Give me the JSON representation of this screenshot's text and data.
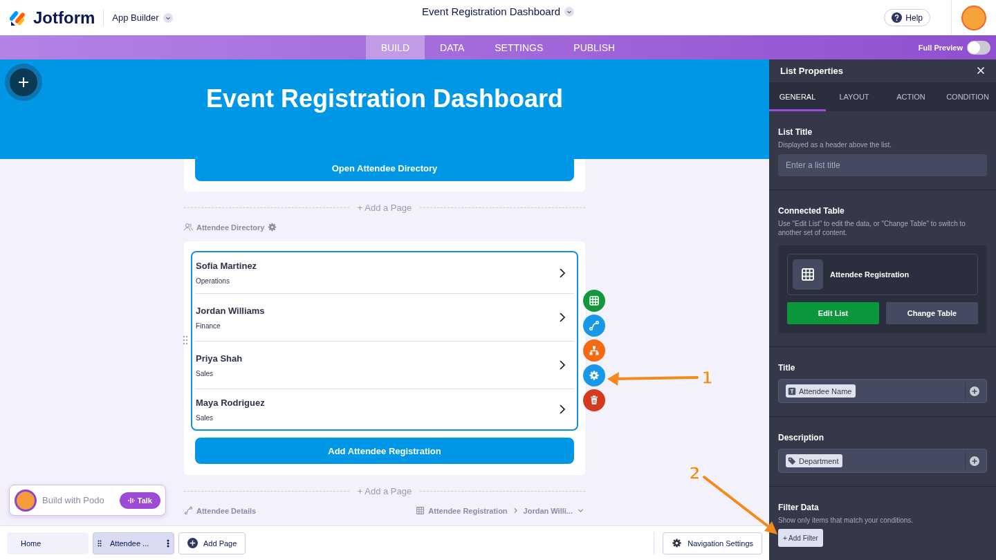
{
  "header": {
    "brand": "Jotform",
    "product": "App Builder",
    "app_title": "Event Registration Dashboard",
    "help": "Help"
  },
  "nav": {
    "tabs": [
      {
        "label": "BUILD",
        "selected": true
      },
      {
        "label": "DATA",
        "selected": false
      },
      {
        "label": "SETTINGS",
        "selected": false
      },
      {
        "label": "PUBLISH",
        "selected": false
      }
    ],
    "full_preview": {
      "label": "Full Preview",
      "on": false
    }
  },
  "canvas": {
    "banner_title": "Event Registration Dashboard",
    "first_page": {
      "button": "Open Attendee Directory"
    },
    "add_page_labels": [
      "+ Add a Page",
      "+ Add a Page"
    ],
    "list_page": {
      "label": "Attendee Directory",
      "items": [
        {
          "title": "Sofia Martinez",
          "description": "Operations"
        },
        {
          "title": "Jordan Williams",
          "description": "Finance"
        },
        {
          "title": "Priya Shah",
          "description": "Sales"
        },
        {
          "title": "Maya Rodriguez",
          "description": "Sales"
        }
      ],
      "add_button": "Add Attendee Registration",
      "actions": [
        {
          "kind": "table"
        },
        {
          "kind": "link"
        },
        {
          "kind": "hierarchy"
        },
        {
          "kind": "settings"
        },
        {
          "kind": "delete"
        }
      ]
    },
    "next_page": {
      "label": "Attendee Details",
      "table": "Attendee Registration",
      "record": "Jordan Willi..."
    },
    "podo": {
      "label": "Build with Podo",
      "button": "Talk"
    }
  },
  "bottom_bar": {
    "pages": [
      {
        "label": "Home",
        "selected": false
      },
      {
        "label": "Attendee ...",
        "selected": true
      }
    ],
    "add_page": "Add Page",
    "navigation_settings": "Navigation Settings"
  },
  "panel": {
    "title": "List Properties",
    "tabs": [
      {
        "label": "GENERAL",
        "selected": true
      },
      {
        "label": "LAYOUT",
        "selected": false
      },
      {
        "label": "ACTION",
        "selected": false
      },
      {
        "label": "CONDITION",
        "selected": false
      }
    ],
    "list_title": {
      "heading": "List Title",
      "hint": "Displayed as a header above the list.",
      "placeholder": "Enter a list title"
    },
    "connected_table": {
      "heading": "Connected Table",
      "hint": "Use \"Edit List\" to edit the data, or \"Change Table\" to switch to another set of content.",
      "table": "Attendee Registration",
      "edit": "Edit List",
      "change": "Change Table"
    },
    "title_field": {
      "heading": "Title",
      "chip": {
        "label": "Attendee Name",
        "kind": "text"
      }
    },
    "description_field": {
      "heading": "Description",
      "chip": {
        "label": "Department",
        "kind": "tag"
      }
    },
    "filter": {
      "heading": "Filter Data",
      "hint": "Show only items that match your conditions.",
      "button": "+ Add Filter"
    }
  },
  "annotations": [
    {
      "label": "1"
    },
    {
      "label": "2"
    }
  ]
}
